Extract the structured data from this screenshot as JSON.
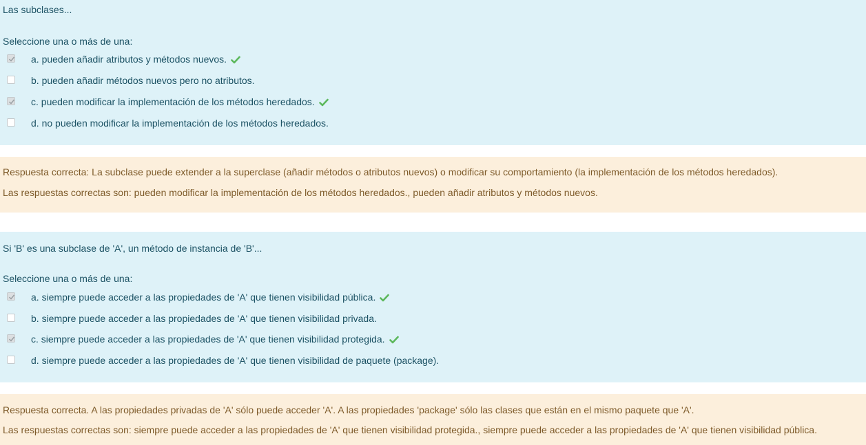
{
  "questions": [
    {
      "text": "Las subclases...",
      "prompt": "Seleccione una o más de una:",
      "options": [
        {
          "label": "a. pueden añadir atributos y métodos nuevos.",
          "checked": true,
          "correct": true
        },
        {
          "label": "b. pueden añadir métodos nuevos pero no atributos.",
          "checked": false,
          "correct": false
        },
        {
          "label": "c. pueden modificar la implementación de los métodos heredados.",
          "checked": true,
          "correct": true
        },
        {
          "label": "d. no pueden modificar la implementación de los métodos heredados.",
          "checked": false,
          "correct": false
        }
      ],
      "feedback": {
        "general": "Respuesta correcta: La subclase puede extender a la superclase (añadir métodos o atributos nuevos) o modificar su comportamiento (la implementación de los métodos heredados).",
        "right_answer": "Las respuestas correctas son: pueden modificar la implementación de los métodos heredados., pueden añadir atributos y métodos nuevos."
      }
    },
    {
      "text": "Si 'B' es una subclase de 'A', un método de instancia de 'B'...",
      "prompt": "Seleccione una o más de una:",
      "options": [
        {
          "label": "a. siempre puede acceder a las propiedades de 'A' que tienen visibilidad pública.",
          "checked": true,
          "correct": true
        },
        {
          "label": "b. siempre puede acceder a las propiedades de 'A' que tienen visibilidad privada.",
          "checked": false,
          "correct": false
        },
        {
          "label": "c. siempre puede acceder a las propiedades de 'A' que tienen visibilidad protegida.",
          "checked": true,
          "correct": true
        },
        {
          "label": "d. siempre puede acceder a las propiedades de 'A' que tienen visibilidad de paquete (package).",
          "checked": false,
          "correct": false
        }
      ],
      "feedback": {
        "general": "Respuesta correcta. A las propiedades privadas de 'A' sólo puede acceder 'A'. A las propiedades 'package' sólo las clases que están en el mismo paquete que 'A'.",
        "right_answer": "Las respuestas correctas son: siempre puede acceder a las propiedades de 'A' que tienen visibilidad protegida., siempre puede acceder a las propiedades de 'A' que tienen visibilidad pública."
      }
    }
  ],
  "colors": {
    "question_bg": "#def2f8",
    "feedback_bg": "#fcefdc",
    "tick": "#5cb85c"
  },
  "icons": {
    "correct": "check-mark-icon",
    "checked": "checkbox-checked-icon"
  }
}
